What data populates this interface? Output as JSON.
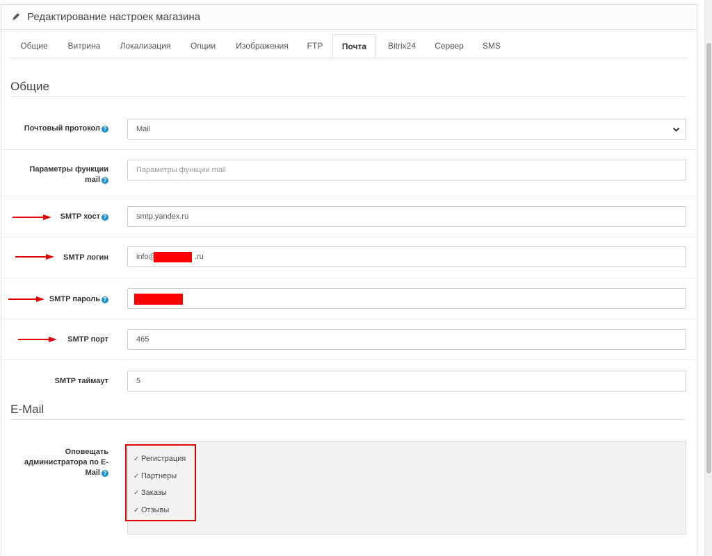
{
  "header": {
    "title": "Редактирование настроек магазина"
  },
  "tabs": [
    {
      "label": "Общие",
      "active": false
    },
    {
      "label": "Витрина",
      "active": false
    },
    {
      "label": "Локализация",
      "active": false
    },
    {
      "label": "Опции",
      "active": false
    },
    {
      "label": "Изображения",
      "active": false
    },
    {
      "label": "FTP",
      "active": false
    },
    {
      "label": "Почта",
      "active": true
    },
    {
      "label": "Bitrix24",
      "active": false
    },
    {
      "label": "Сервер",
      "active": false
    },
    {
      "label": "SMS",
      "active": false
    }
  ],
  "sections": {
    "general": "Общие",
    "email": "E-Mail"
  },
  "fields": {
    "mail_protocol": {
      "label": "Почтовый протокол",
      "value": "Mail"
    },
    "mail_params": {
      "label_line1": "Параметры функции",
      "label_line2": "mail",
      "placeholder": "Параметры функции mail"
    },
    "smtp_host": {
      "label": "SMTP хост",
      "value": "smtp.yandex.ru"
    },
    "smtp_login": {
      "label": "SMTP логин",
      "value_prefix": "info@",
      "value_suffix": ".ru"
    },
    "smtp_password": {
      "label": "SMTP пароль"
    },
    "smtp_port": {
      "label": "SMTP порт",
      "value": "465"
    },
    "smtp_timeout": {
      "label": "SMTP таймаут",
      "value": "5"
    },
    "admin_notify": {
      "label_line1": "Оповещать",
      "label_line2": "администратора по E-",
      "label_line3": "Mail",
      "options": [
        {
          "label": "Регистрация",
          "checked": true
        },
        {
          "label": "Партнеры",
          "checked": true
        },
        {
          "label": "Заказы",
          "checked": true
        },
        {
          "label": "Отзывы",
          "checked": true
        }
      ]
    }
  },
  "icons": {
    "help": "?",
    "check": "✓"
  },
  "colors": {
    "accent": "#1e91cf",
    "annotation_red": "#e00000"
  }
}
